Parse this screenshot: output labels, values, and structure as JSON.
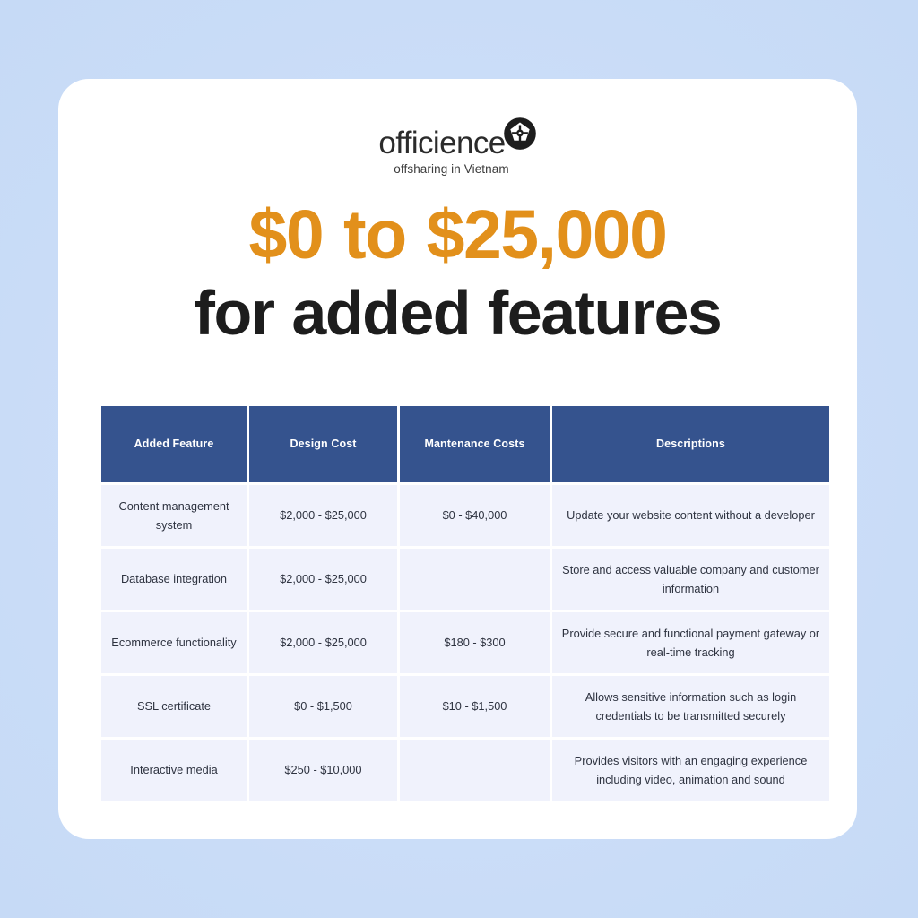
{
  "brand": {
    "wordmark": "officience",
    "tagline": "offsharing in Vietnam",
    "logo_icon": "officience-flower-mark-icon",
    "accent_color": "#e2901b",
    "table_header_color": "#35538e",
    "page_background_color": "#cddff9",
    "card_background_color": "#ffffff",
    "row_background_color": "#f0f2fc"
  },
  "headline": {
    "amount": "$0 to $25,000",
    "subject": "for added features"
  },
  "table": {
    "columns": [
      "Added Feature",
      "Design Cost",
      "Mantenance Costs",
      "Descriptions"
    ],
    "rows": [
      {
        "feature": "Content management system",
        "design_cost": "$2,000 - $25,000",
        "maintenance_cost": "$0 - $40,000",
        "description": "Update your website content without a developer"
      },
      {
        "feature": "Database integration",
        "design_cost": "$2,000 - $25,000",
        "maintenance_cost": "",
        "description": "Store and access valuable company and customer information"
      },
      {
        "feature": "Ecommerce functionality",
        "design_cost": "$2,000 - $25,000",
        "maintenance_cost": "$180 - $300",
        "description": "Provide secure and functional payment gateway or real-time tracking"
      },
      {
        "feature": "SSL certificate",
        "design_cost": "$0 - $1,500",
        "maintenance_cost": "$10 - $1,500",
        "description": "Allows sensitive information such as login credentials to be transmitted securely"
      },
      {
        "feature": "Interactive media",
        "design_cost": "$250 - $10,000",
        "maintenance_cost": "",
        "description": "Provides visitors with an engaging experience including video, animation and sound"
      }
    ]
  }
}
